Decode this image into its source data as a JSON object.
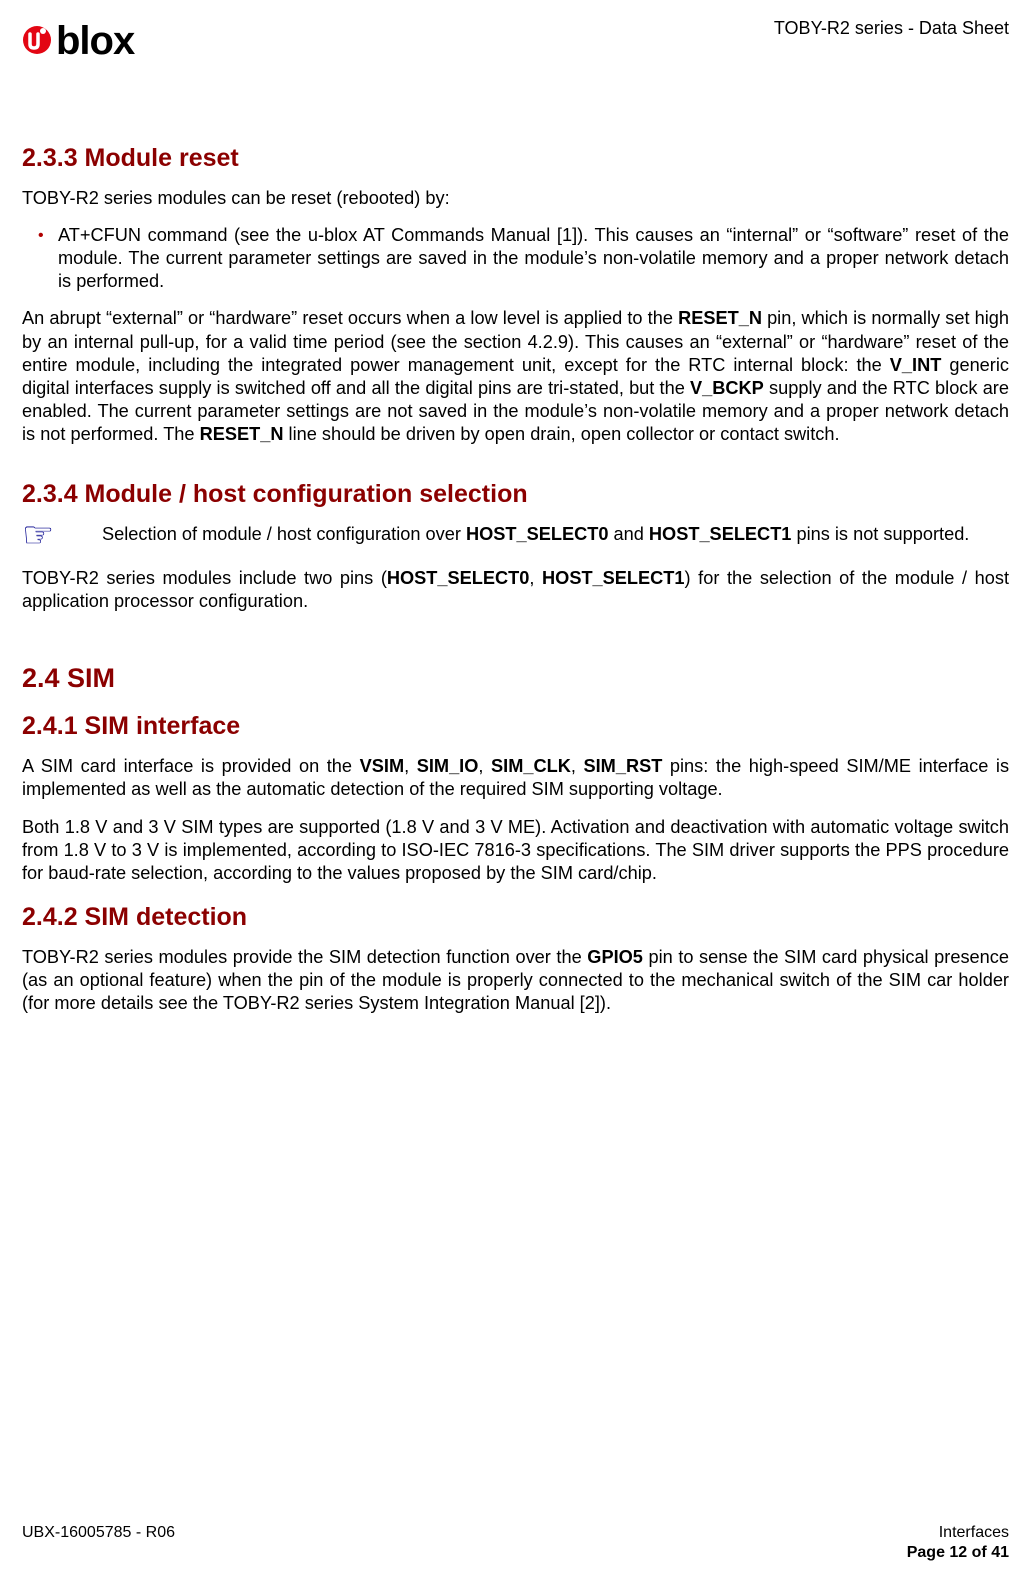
{
  "header": {
    "logo_text": "blox",
    "doc_title": "TOBY-R2 series - Data Sheet"
  },
  "sections": {
    "s233": {
      "heading": "2.3.3    Module reset",
      "p1": "TOBY-R2 series modules can be reset (rebooted) by:",
      "li1": "AT+CFUN command (see the u-blox AT Commands Manual [1]). This causes an “internal” or “software” reset of the module. The current parameter settings are saved in the module’s non-volatile memory and a proper network detach is performed.",
      "p2a": "An abrupt “external” or “hardware” reset occurs when a low level is applied to the ",
      "p2b_bold": "RESET_N",
      "p2c": " pin, which is normally set high by an internal pull-up, for a valid time period (see the section 4.2.9). This causes an “external” or “hardware” reset of the entire module, including the integrated power management unit, except for the RTC internal block: the ",
      "p2d_bold": "V_INT",
      "p2e": " generic digital interfaces supply is switched off and all the digital pins are tri-stated, but the ",
      "p2f_bold": "V_BCKP",
      "p2g": " supply and the RTC block are enabled. The current parameter settings are not saved in the module’s non-volatile memory and a proper network detach is not performed. The ",
      "p2h_bold": "RESET_N",
      "p2i": " line should be driven by open drain, open collector or contact switch."
    },
    "s234": {
      "heading": "2.3.4    Module / host configuration selection",
      "note_a": "Selection of module / host configuration over ",
      "note_b_bold": "HOST_SELECT0",
      "note_c": " and ",
      "note_d_bold": "HOST_SELECT1",
      "note_e": " pins is not supported.",
      "p1a": "TOBY-R2 series modules include two pins (",
      "p1b_bold": "HOST_SELECT0",
      "p1c": ", ",
      "p1d_bold": "HOST_SELECT1",
      "p1e": ") for the selection of the module / host application processor configuration."
    },
    "s24": {
      "heading": "2.4    SIM"
    },
    "s241": {
      "heading": "2.4.1    SIM interface",
      "p1a": "A SIM card interface is provided on the ",
      "p1b_bold": "VSIM",
      "p1c": ", ",
      "p1d_bold": "SIM_IO",
      "p1e": ", ",
      "p1f_bold": "SIM_CLK",
      "p1g": ", ",
      "p1h_bold": "SIM_RST",
      "p1i": " pins: the high-speed SIM/ME interface is implemented as well as the automatic detection of the required SIM supporting voltage.",
      "p2": "Both 1.8 V and 3 V SIM types are supported (1.8 V and 3 V ME). Activation and deactivation with automatic voltage switch from 1.8 V to 3 V is implemented, according to ISO-IEC 7816-3 specifications. The SIM driver supports the PPS procedure for baud-rate selection, according to the values proposed by the SIM card/chip."
    },
    "s242": {
      "heading": "2.4.2    SIM detection",
      "p1a": "TOBY-R2 series modules provide the SIM detection function over the ",
      "p1b_bold": "GPIO5",
      "p1c": " pin to sense the SIM card physical presence (as an optional feature) when the pin of the module is properly connected to the mechanical switch of the SIM car holder (for more details see the TOBY-R2 series System Integration Manual [2])."
    }
  },
  "footer": {
    "left": "UBX-16005785 - R06",
    "right_top": "Interfaces",
    "right_bottom": "Page 12 of 41"
  }
}
